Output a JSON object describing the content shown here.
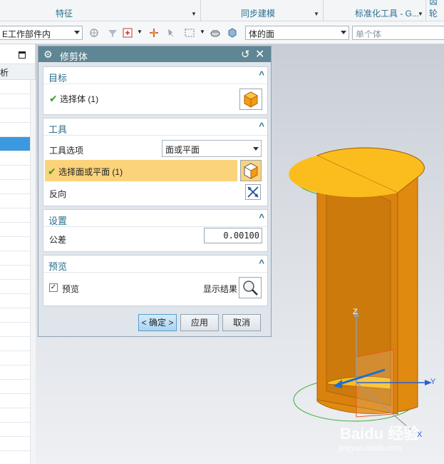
{
  "ribbon": {
    "groups": [
      {
        "label": "特征"
      },
      {
        "label": "同步建模"
      },
      {
        "label": "标准化工具 - G..."
      },
      {
        "label": "齿轮"
      }
    ]
  },
  "toolbar": {
    "scope_combo": "E工作部件内",
    "face_filter_combo": "体的面",
    "body_filter_placeholder": "单个体"
  },
  "navigator": {
    "column_header": "析"
  },
  "dialog": {
    "title": "修剪体",
    "target": {
      "title": "目标",
      "select_body_label": "选择体 (1)"
    },
    "tool": {
      "title": "工具",
      "tool_option_label": "工具选项",
      "tool_option_value": "面或平面",
      "select_face_label": "选择面或平面 (1)",
      "reverse_label": "反向"
    },
    "settings": {
      "title": "设置",
      "tolerance_label": "公差",
      "tolerance_value": "0.00100"
    },
    "preview": {
      "title": "预览",
      "preview_label": "预览",
      "preview_checked": true,
      "show_result_label": "显示结果"
    },
    "buttons": {
      "ok": "< 确定 >",
      "apply": "应用",
      "cancel": "取消"
    }
  },
  "viewport": {
    "axis_z": "Z",
    "axis_y": "Y",
    "axis_x": "X",
    "watermark": "Baidu 经验",
    "watermark_url": "jingyan.baidu.com"
  },
  "colors": {
    "accent": "#2a6f8c",
    "title_bar": "#5e8694",
    "highlight_row": "#fbd37a",
    "model_orange": "#e08a10",
    "model_top": "#fbbd1e",
    "selection_blue": "#3b99e0"
  }
}
